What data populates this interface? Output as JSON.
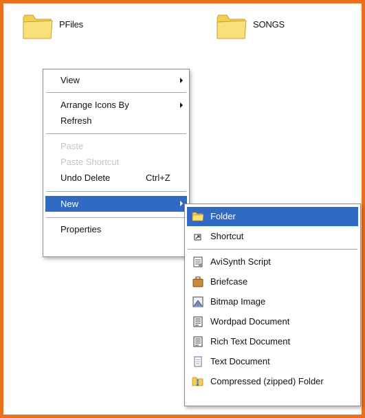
{
  "desktop": {
    "folders": [
      {
        "label": "PFiles",
        "icon": "folder-icon"
      },
      {
        "label": "SONGS",
        "icon": "folder-icon"
      }
    ]
  },
  "context_menu": {
    "view": "View",
    "arrange": "Arrange Icons By",
    "refresh": "Refresh",
    "paste": "Paste",
    "paste_shortcut": "Paste Shortcut",
    "undo": "Undo Delete",
    "undo_key": "Ctrl+Z",
    "new": "New",
    "properties": "Properties"
  },
  "submenu": {
    "folder": "Folder",
    "shortcut": "Shortcut",
    "avisynth": "AviSynth Script",
    "briefcase": "Briefcase",
    "bitmap": "Bitmap Image",
    "wordpad": "Wordpad Document",
    "rich_text": "Rich Text Document",
    "text": "Text Document",
    "compressed": "Compressed (zipped) Folder"
  },
  "colors": {
    "frame_border": "#e8701f",
    "selection": "#316ac5",
    "folder_yellow": "#f5d860"
  }
}
